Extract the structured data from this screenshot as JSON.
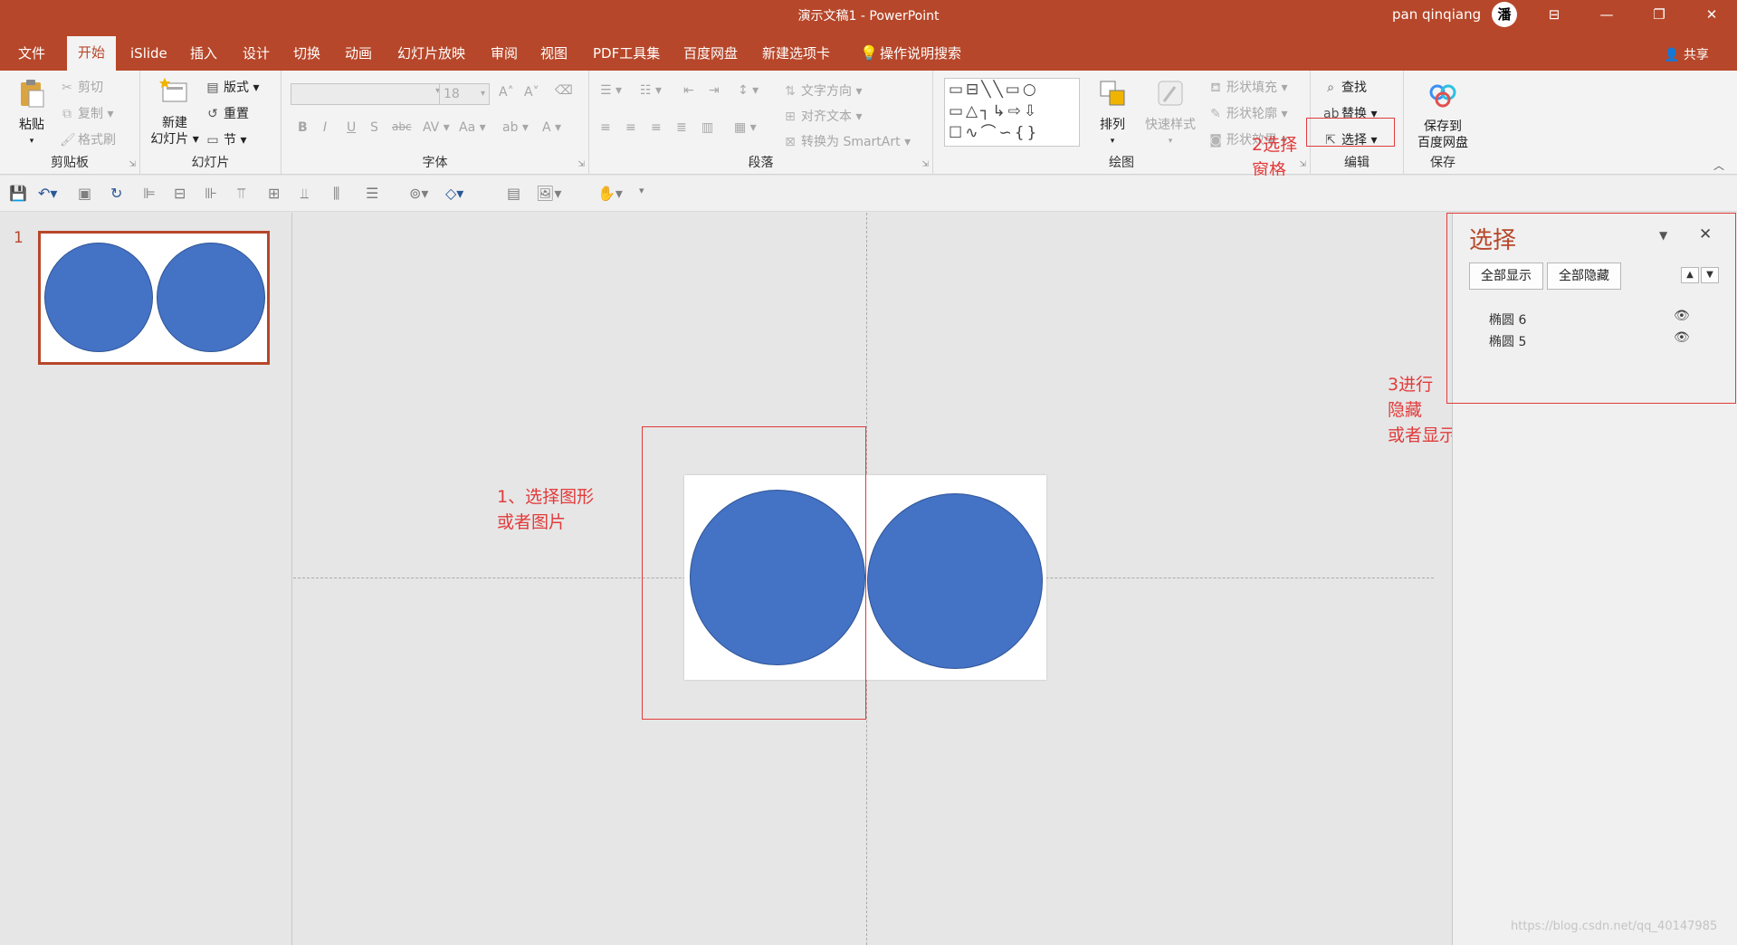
{
  "titlebar": {
    "title": "演示文稿1  -  PowerPoint",
    "user": "pan qinqiang",
    "avatar_text": "潘",
    "controls": [
      "ribbon-display",
      "minimize",
      "restore",
      "close"
    ]
  },
  "tabs": [
    {
      "label": "文件",
      "active": false
    },
    {
      "label": "开始",
      "active": true
    },
    {
      "label": "iSlide",
      "active": false
    },
    {
      "label": "插入",
      "active": false
    },
    {
      "label": "设计",
      "active": false
    },
    {
      "label": "切换",
      "active": false
    },
    {
      "label": "动画",
      "active": false
    },
    {
      "label": "幻灯片放映",
      "active": false
    },
    {
      "label": "审阅",
      "active": false
    },
    {
      "label": "视图",
      "active": false
    },
    {
      "label": "PDF工具集",
      "active": false
    },
    {
      "label": "百度网盘",
      "active": false
    },
    {
      "label": "新建选项卡",
      "active": false
    },
    {
      "label": "操作说明搜索",
      "active": false
    }
  ],
  "share_label": "共享",
  "ribbon": {
    "clipboard": {
      "label": "剪贴板",
      "paste": "粘贴",
      "cut": "剪切",
      "copy": "复制",
      "format_painter": "格式刷"
    },
    "slides": {
      "label": "幻灯片",
      "new_slide_line1": "新建",
      "new_slide_line2": "幻灯片",
      "layout": "版式",
      "reset": "重置",
      "section": "节"
    },
    "font": {
      "label": "字体",
      "font_name": "",
      "font_size": "18"
    },
    "paragraph": {
      "label": "段落",
      "text_direction": "文字方向",
      "align_text": "对齐文本",
      "convert_smartart": "转换为 SmartArt"
    },
    "drawing": {
      "label": "绘图",
      "arrange": "排列",
      "quick_styles": "快速样式",
      "shape_fill": "形状填充",
      "shape_outline": "形状轮廓",
      "shape_effects": "形状效果"
    },
    "editing": {
      "label": "编辑",
      "find": "查找",
      "replace": "替换",
      "select": "选择"
    },
    "save": {
      "label": "保存",
      "save_line1": "保存到",
      "save_line2": "百度网盘"
    }
  },
  "slides": [
    {
      "number": "1"
    }
  ],
  "selection_pane": {
    "title": "选择",
    "show_all": "全部显示",
    "hide_all": "全部隐藏",
    "items": [
      {
        "name": "椭圆 6",
        "visible": true
      },
      {
        "name": "椭圆 5",
        "visible": true
      }
    ]
  },
  "annotations": {
    "step1_line1": "1、选择图形",
    "step1_line2": "或者图片",
    "step2_line1": "2选择",
    "step2_line2": "窗格",
    "step3_line1": "3进行",
    "step3_line2": "隐藏",
    "step3_line3": "或者显示"
  },
  "colors": {
    "accent": "#b7472a",
    "shape_fill": "#4472c4",
    "annotation_red": "#e23b3b"
  },
  "watermark": "https://blog.csdn.net/qq_40147985"
}
